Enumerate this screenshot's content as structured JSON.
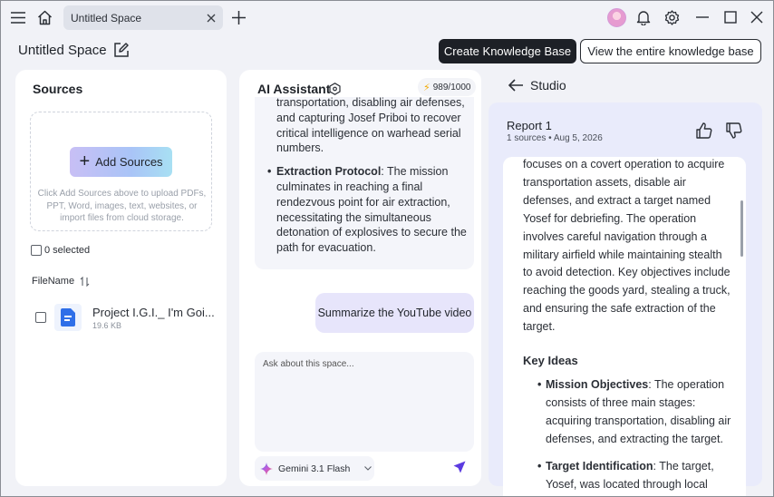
{
  "titlebar": {
    "tab_label": "Untitled Space"
  },
  "header": {
    "space_title": "Untitled Space",
    "create_kb_label": "Create Knowledge Base",
    "view_kb_label": "View the entire knowledge base"
  },
  "sources": {
    "title": "Sources",
    "add_label": "Add Sources",
    "hint": "Click Add Sources above to upload PDFs, PPT, Word, images, text, websites, or import files from cloud storage.",
    "selected": "0 selected",
    "column_header": "FileName",
    "files": [
      {
        "name": "Project I.G.I._ I'm Goi...",
        "size": "19.6 KB"
      }
    ]
  },
  "assistant": {
    "title": "AI Assistant",
    "credits": "989/1000",
    "msg_part1": "transportation, disabling air defenses, and capturing Josef Priboi to recover critical intelligence on warhead serial numbers.",
    "msg_bullet_title": "Extraction Protocol",
    "msg_bullet_body": ": The mission culminates in reaching a final rendezvous point for air extraction, necessitating the simultaneous detonation of explosives to secure the path for evacuation.",
    "user_message": "Summarize the YouTube video",
    "ask_placeholder": "Ask about this space...",
    "model": "Gemini 3.1 Flash"
  },
  "studio": {
    "title": "Studio",
    "report_title": "Report 1",
    "report_meta": "1 sources • Aug 5, 2026",
    "para": "focuses on a covert operation to acquire transportation assets, disable air defenses, and extract a target named Yosef for debriefing. The operation involves careful navigation through a military airfield while maintaining stealth to avoid detection. Key objectives include reaching the goods yard, stealing a truck, and ensuring the safe extraction of the target.",
    "key_ideas": "Key Ideas",
    "b1_title": "Mission Objectives",
    "b1_body": ": The operation consists of three main stages: acquiring transportation, disabling air defenses, and extracting the target.",
    "b2_title": "Target Identification",
    "b2_body": ": The target, Yosef, was located through local"
  }
}
